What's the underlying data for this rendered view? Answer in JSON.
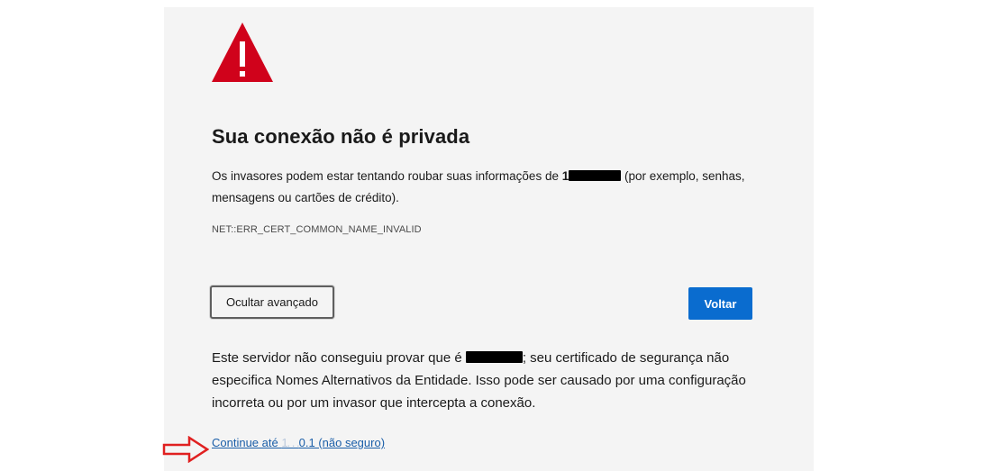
{
  "error_page": {
    "title": "Sua conexão não é privada",
    "description_part1": "Os invasores podem estar tentando roubar suas informações de ",
    "description_redacted_prefix": "1",
    "description_part2": " (por exemplo, senhas, mensagens ou cartões de crédito).",
    "error_code": "NET::ERR_CERT_COMMON_NAME_INVALID",
    "advanced_button_label": "Ocultar avançado",
    "back_button_label": "Voltar",
    "details_part1": "Este servidor não conseguiu provar que é ",
    "details_part2": "; seu certificado de segurança não especifica Nomes Alternativos da Entidade. Isso pode ser causado por uma configuração incorreta ou por um invasor que intercepta a conexão.",
    "proceed_link_prefix": "Continue até ",
    "proceed_link_faded": "1. . .",
    "proceed_link_suffix": "0.1 (não seguro)"
  },
  "icons": {
    "warning": "warning-triangle-icon",
    "annotation_arrow": "red-outline-arrow-icon"
  },
  "colors": {
    "warning_red": "#d0021b",
    "primary_button": "#0a6ccf",
    "link": "#1a5ea8",
    "annotation_arrow": "#e02020"
  }
}
